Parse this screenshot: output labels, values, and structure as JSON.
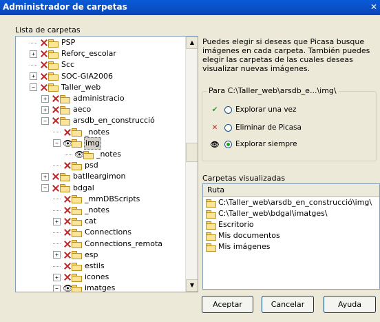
{
  "window": {
    "title": "Administrador de carpetas",
    "close_glyph": "✕"
  },
  "tree": {
    "label": "Lista de carpetas",
    "rows": [
      {
        "text": "PSP",
        "exp": "",
        "mark": "x"
      },
      {
        "text": "Reforç_escolar",
        "exp": "+",
        "mark": "x"
      },
      {
        "text": "Scc",
        "exp": "",
        "mark": "x"
      },
      {
        "text": "SOC-GIA2006",
        "exp": "+",
        "mark": "x"
      },
      {
        "text": "Taller_web",
        "exp": "−",
        "mark": "x"
      },
      {
        "text": "administracio",
        "exp": "+",
        "mark": "x"
      },
      {
        "text": "aeco",
        "exp": "+",
        "mark": "x"
      },
      {
        "text": "arsdb_en_construcció",
        "exp": "−",
        "mark": "x"
      },
      {
        "text": "_notes",
        "exp": "",
        "mark": "x"
      },
      {
        "text": "img",
        "exp": "−",
        "mark": "eye",
        "selected": true
      },
      {
        "text": "_notes",
        "exp": "",
        "mark": "eye"
      },
      {
        "text": "psd",
        "exp": "",
        "mark": "x"
      },
      {
        "text": "batlleargimon",
        "exp": "+",
        "mark": "x"
      },
      {
        "text": "bdgal",
        "exp": "−",
        "mark": "x"
      },
      {
        "text": "_mmDBScripts",
        "exp": "",
        "mark": "x"
      },
      {
        "text": "_notes",
        "exp": "",
        "mark": "x"
      },
      {
        "text": "cat",
        "exp": "+",
        "mark": "x"
      },
      {
        "text": "Connections",
        "exp": "",
        "mark": "x"
      },
      {
        "text": "Connections_remota",
        "exp": "",
        "mark": "x"
      },
      {
        "text": "esp",
        "exp": "+",
        "mark": "x"
      },
      {
        "text": "estils",
        "exp": "",
        "mark": "x"
      },
      {
        "text": "icones",
        "exp": "+",
        "mark": "x"
      },
      {
        "text": "imatges",
        "exp": "−",
        "mark": "eye"
      }
    ]
  },
  "description": "Puedes elegir si deseas que Picasa busque imágenes en cada carpeta. También puedes elegir las carpetas de las cuales deseas visualizar nuevas imágenes.",
  "options": {
    "legend": "Para C:\\Taller_web\\arsdb_e...\\img\\",
    "items": [
      {
        "icon": "✔",
        "label": "Explorar una vez",
        "selected": false,
        "color": "#2e9a2e"
      },
      {
        "icon": "✕",
        "label": "Eliminar de Picasa",
        "selected": false,
        "color": "#c0282a"
      },
      {
        "icon": "👁",
        "label": "Explorar siempre",
        "selected": true,
        "color": "#000000"
      }
    ]
  },
  "watched": {
    "label": "Carpetas visualizadas",
    "column": "Ruta",
    "items": [
      {
        "text": "C:\\Taller_web\\arsdb_en_construcció\\img\\",
        "icon": "folder"
      },
      {
        "text": "C:\\Taller_web\\bdgal\\imatges\\",
        "icon": "folder"
      },
      {
        "text": "Escritorio",
        "icon": "folder"
      },
      {
        "text": "Mis documentos",
        "icon": "folder"
      },
      {
        "text": "Mis imágenes",
        "icon": "pictures-folder"
      }
    ]
  },
  "buttons": {
    "ok": "Aceptar",
    "cancel": "Cancelar",
    "help": "Ayuda"
  },
  "scroll": {
    "up": "▲",
    "down": "▼"
  }
}
